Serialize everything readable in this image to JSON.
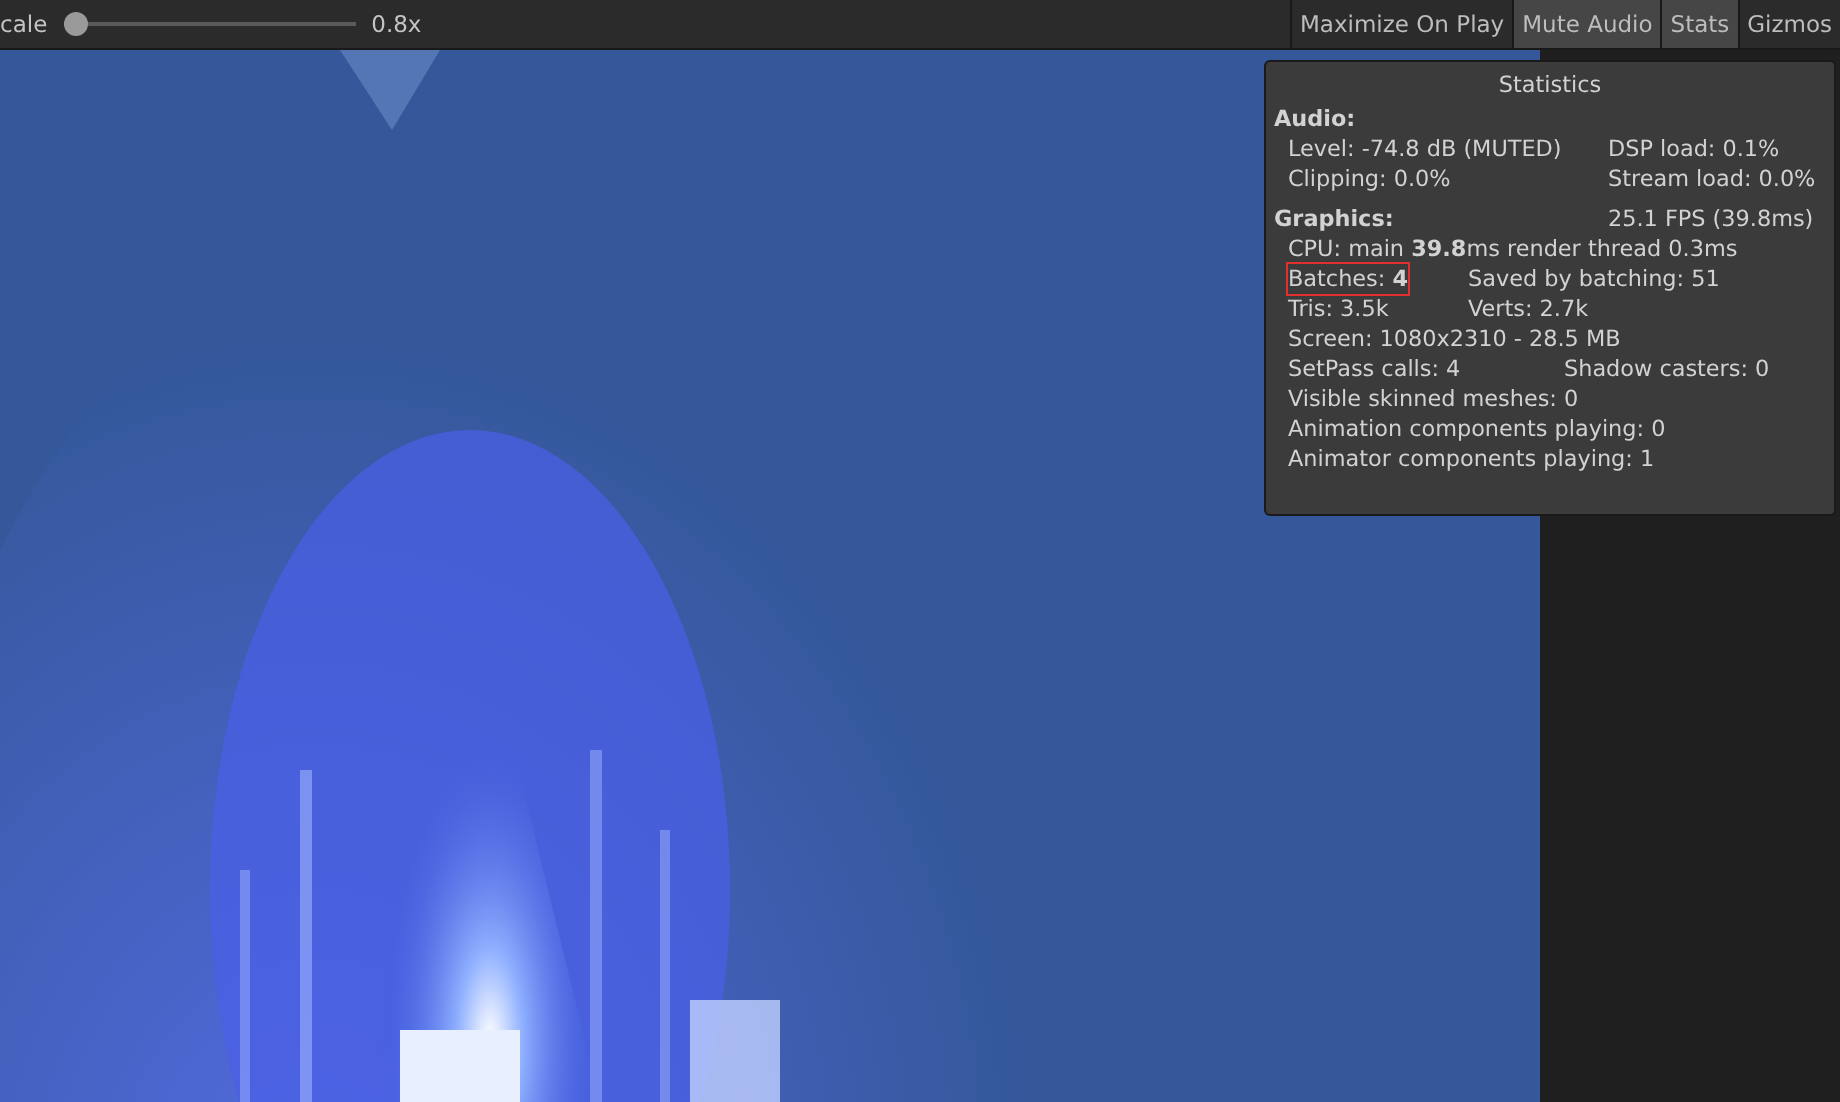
{
  "toolbar": {
    "scale_label": "cale",
    "scale_slider": {
      "level": 0.0
    },
    "scale_value": "0.8x",
    "buttons": [
      {
        "label": "Maximize On Play",
        "on": false
      },
      {
        "label": "Mute Audio",
        "on": true
      },
      {
        "label": "Stats",
        "on": true
      },
      {
        "label": "Gizmos",
        "on": false
      }
    ]
  },
  "statistics": {
    "title": "Statistics",
    "audio": {
      "heading": "Audio:",
      "rows": [
        {
          "kind": "wide",
          "left": "Level: -74.8 dB (MUTED)",
          "right": "DSP load: 0.1%",
          "highlighted": false
        },
        {
          "kind": "wide",
          "left": "Clipping: 0.0%",
          "right": "Stream load: 0.0%",
          "highlighted": false
        }
      ]
    },
    "graphics": {
      "heading": "Graphics:",
      "fps": "25.1 FPS (39.8ms)",
      "rows": [
        {
          "kind": "single",
          "left": "CPU: main **39.8**ms  render thread 0.3ms",
          "highlighted": false
        },
        {
          "kind": "narrow",
          "left": "Batches: **4**",
          "right": "Saved by batching: 51",
          "highlighted": true
        },
        {
          "kind": "narrow",
          "left": "Tris: 3.5k",
          "right": "Verts: 2.7k",
          "highlighted": false
        },
        {
          "kind": "single",
          "left": "Screen: 1080x2310 - 28.5 MB",
          "highlighted": false
        },
        {
          "kind": "medium",
          "left": "SetPass calls: 4",
          "right": "Shadow casters: 0",
          "highlighted": false
        },
        {
          "kind": "single",
          "left": "Visible skinned meshes: 0",
          "highlighted": false
        },
        {
          "kind": "single",
          "left": "Animation components playing: 0",
          "highlighted": false
        },
        {
          "kind": "single",
          "left": "Animator components playing: 1",
          "highlighted": false
        }
      ]
    }
  }
}
